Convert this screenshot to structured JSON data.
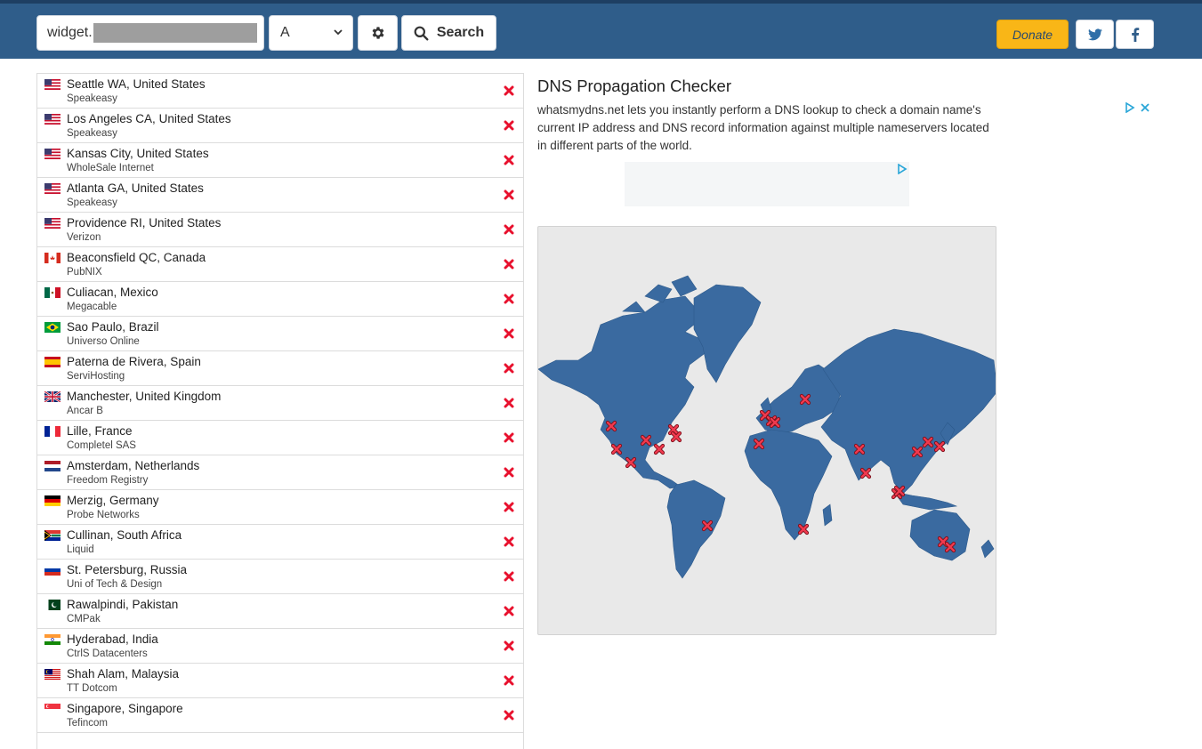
{
  "search": {
    "domain_prefix": "widget.",
    "record_type": "A",
    "search_label": "Search"
  },
  "header": {
    "donate_label": "Donate"
  },
  "colors": {
    "header_bg": "#2f5d8a",
    "donate_bg": "#f9b617",
    "fail_icon": "#e8102d",
    "map_land": "#3a6aa0"
  },
  "icons": {
    "settings": "gear-icon",
    "search": "search-icon",
    "twitter": "twitter-icon",
    "facebook": "facebook-icon",
    "status": "red-x-icon"
  },
  "results": [
    {
      "location": "Seattle WA, United States",
      "provider": "Speakeasy",
      "flag": "us",
      "status": "fail"
    },
    {
      "location": "Los Angeles CA, United States",
      "provider": "Speakeasy",
      "flag": "us",
      "status": "fail"
    },
    {
      "location": "Kansas City, United States",
      "provider": "WholeSale Internet",
      "flag": "us",
      "status": "fail"
    },
    {
      "location": "Atlanta GA, United States",
      "provider": "Speakeasy",
      "flag": "us",
      "status": "fail"
    },
    {
      "location": "Providence RI, United States",
      "provider": "Verizon",
      "flag": "us",
      "status": "fail"
    },
    {
      "location": "Beaconsfield QC, Canada",
      "provider": "PubNIX",
      "flag": "ca",
      "status": "fail"
    },
    {
      "location": "Culiacan, Mexico",
      "provider": "Megacable",
      "flag": "mx",
      "status": "fail"
    },
    {
      "location": "Sao Paulo, Brazil",
      "provider": "Universo Online",
      "flag": "br",
      "status": "fail"
    },
    {
      "location": "Paterna de Rivera, Spain",
      "provider": "ServiHosting",
      "flag": "es",
      "status": "fail"
    },
    {
      "location": "Manchester, United Kingdom",
      "provider": "Ancar B",
      "flag": "gb",
      "status": "fail"
    },
    {
      "location": "Lille, France",
      "provider": "Completel SAS",
      "flag": "fr",
      "status": "fail"
    },
    {
      "location": "Amsterdam, Netherlands",
      "provider": "Freedom Registry",
      "flag": "nl",
      "status": "fail"
    },
    {
      "location": "Merzig, Germany",
      "provider": "Probe Networks",
      "flag": "de",
      "status": "fail"
    },
    {
      "location": "Cullinan, South Africa",
      "provider": "Liquid",
      "flag": "za",
      "status": "fail"
    },
    {
      "location": "St. Petersburg, Russia",
      "provider": "Uni of Tech & Design",
      "flag": "ru",
      "status": "fail"
    },
    {
      "location": "Rawalpindi, Pakistan",
      "provider": "CMPak",
      "flag": "pk",
      "status": "fail"
    },
    {
      "location": "Hyderabad, India",
      "provider": "CtrlS Datacenters",
      "flag": "in",
      "status": "fail"
    },
    {
      "location": "Shah Alam, Malaysia",
      "provider": "TT Dotcom",
      "flag": "my",
      "status": "fail"
    },
    {
      "location": "Singapore, Singapore",
      "provider": "Tefincom",
      "flag": "sg",
      "status": "fail"
    },
    {
      "location": "",
      "provider": "",
      "flag": "",
      "status": ""
    }
  ],
  "main": {
    "title": "DNS Propagation Checker",
    "description": "whatsmydns.net lets you instantly perform a DNS lookup to check a domain name's current IP address and DNS record information against multiple nameservers located in different parts of the world."
  }
}
